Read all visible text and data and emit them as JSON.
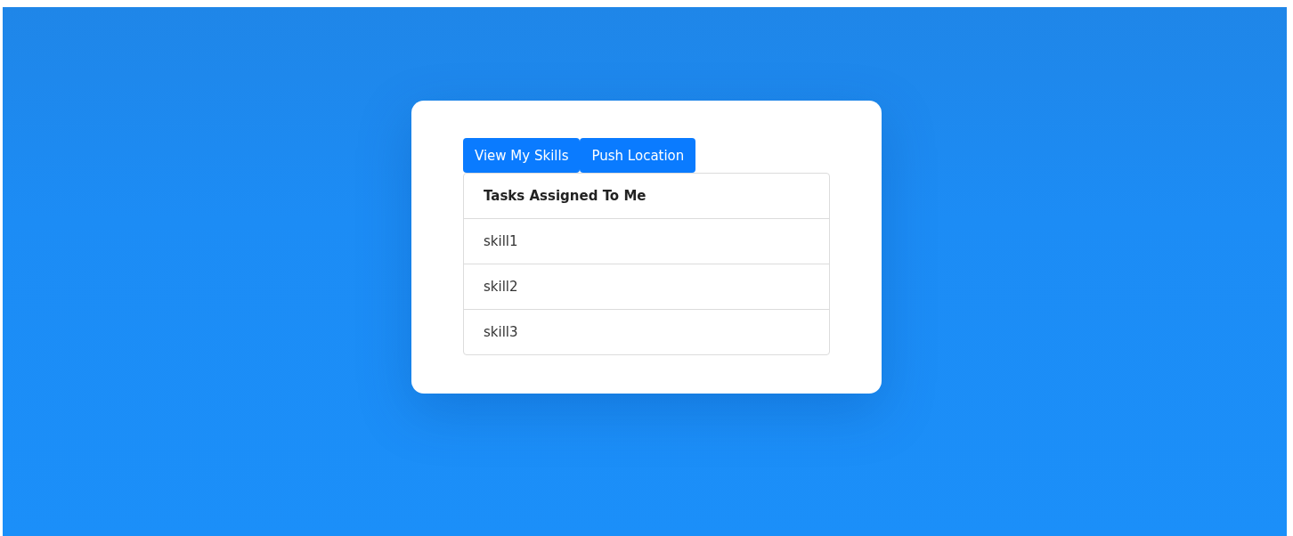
{
  "buttons": [
    {
      "label": "View My Skills"
    },
    {
      "label": "Push Location"
    }
  ],
  "list": {
    "header": "Tasks Assigned To Me",
    "items": [
      "skill1",
      "skill2",
      "skill3"
    ]
  }
}
